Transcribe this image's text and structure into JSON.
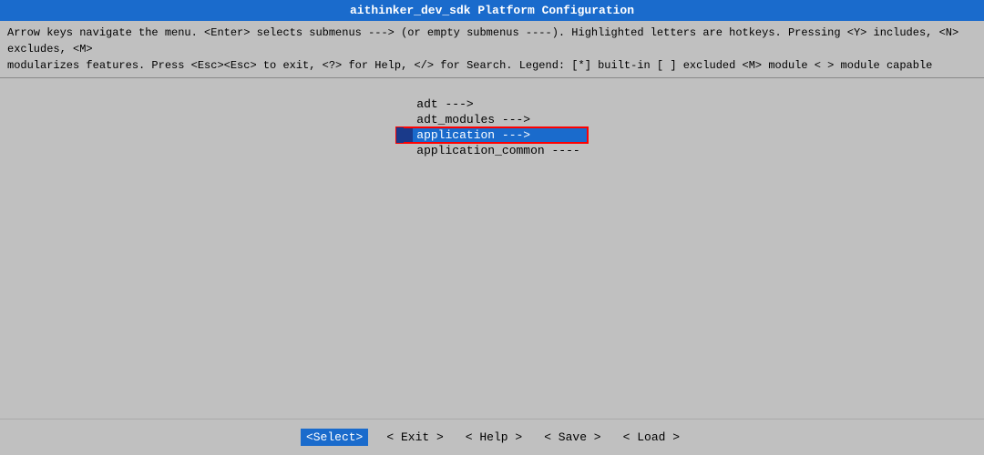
{
  "titleBar": {
    "text": "aithinker_dev_sdk Platform Configuration"
  },
  "helpText": {
    "line1": "Arrow keys navigate the menu.  <Enter> selects submenus ---> (or empty submenus ----).  Highlighted letters are hotkeys.  Pressing <Y> includes, <N> excludes, <M>",
    "line2": "modularizes features.  Press <Esc><Esc> to exit, <?> for Help, </> for Search.  Legend: [*] built-in  [ ] excluded  <M> module  < > module capable"
  },
  "menu": {
    "items": [
      {
        "label": "adt  --->",
        "highlighted": false
      },
      {
        "label": "adt_modules  --->",
        "highlighted": false
      },
      {
        "label": "application  --->",
        "highlighted": true
      },
      {
        "label": "application_common  ----",
        "highlighted": false
      }
    ]
  },
  "bottomBar": {
    "buttons": [
      {
        "label": "<Select>",
        "active": true
      },
      {
        "label": "< Exit >",
        "active": false
      },
      {
        "label": "< Help >",
        "active": false
      },
      {
        "label": "< Save >",
        "active": false
      },
      {
        "label": "< Load >",
        "active": false
      }
    ]
  }
}
